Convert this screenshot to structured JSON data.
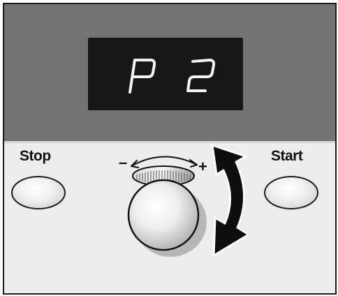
{
  "display": {
    "digit_left": "P",
    "digit_right": "2"
  },
  "controls": {
    "stop_label": "Stop",
    "start_label": "Start",
    "minus_sign": "–",
    "plus_sign": "+"
  },
  "colors": {
    "top_panel": "#737373",
    "bottom_panel": "#ececec",
    "display_bg": "#171717",
    "segment": "#f2f2f2",
    "arrow": "#0e0e0e"
  },
  "icons": {
    "rotate_arrow": "curved-double-arrow-icon",
    "knob_arc": "knob-direction-arc-icon"
  }
}
